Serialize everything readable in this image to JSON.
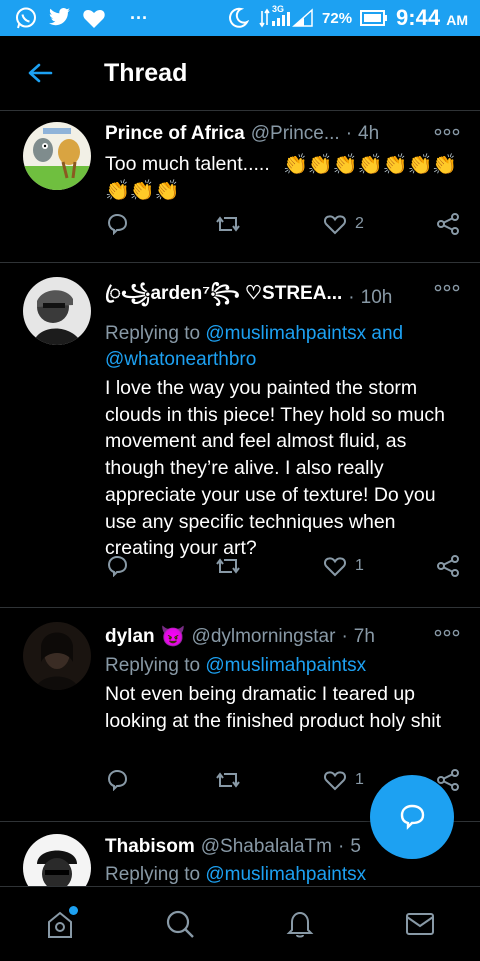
{
  "status_bar": {
    "battery": "72%",
    "time": "9:44",
    "ampm": "AM",
    "network": "3G",
    "dots": "···"
  },
  "header": {
    "title": "Thread"
  },
  "tweets": [
    {
      "name": "Prince of Africa",
      "handle": "@Prince...",
      "age": "4h",
      "text": "Too much talent.....",
      "emoji_line": "👏👏👏👏👏👏👏👏👏👏",
      "likes": "2"
    },
    {
      "name": "ꦿ꧁arden⁷꧂ ♡STREA...",
      "age": "10h",
      "replying_prefix": "Replying to",
      "mention1": "@muslimahpaintsx",
      "and": "and",
      "mention2": "@whatonearthbro",
      "text": "I love the way you painted the storm clouds in this piece! They hold so much movement and feel almost fluid, as though they’re alive. I also really appreciate your use of texture! Do you use any specific techniques when creating your art?",
      "likes": "1"
    },
    {
      "name": "dylan",
      "emoji": "😈",
      "handle": "@dylmorningstar",
      "age": "7h",
      "replying_prefix": "Replying to",
      "mention1": "@muslimahpaintsx",
      "text": "Not even being dramatic I teared up looking at the finished product holy shit",
      "likes": "1"
    },
    {
      "name": "Thabisom",
      "handle": "@ShabalalaTm",
      "age": "5",
      "replying_prefix": "Replying to",
      "mention1": "@muslimahpaintsx"
    }
  ],
  "icons": [
    "whatsapp-icon",
    "twitter-icon",
    "heart-icon",
    "moon-icon",
    "signal-icon",
    "battery-icon",
    "back-arrow-icon",
    "more-icon",
    "reply-icon",
    "retweet-icon",
    "like-icon",
    "share-icon",
    "compose-icon",
    "home-icon",
    "search-icon",
    "bell-icon",
    "mail-icon"
  ],
  "colors": {
    "accent": "#1da1f2",
    "muted": "#8899a6",
    "background": "#000000",
    "divider": "#2f3336"
  }
}
